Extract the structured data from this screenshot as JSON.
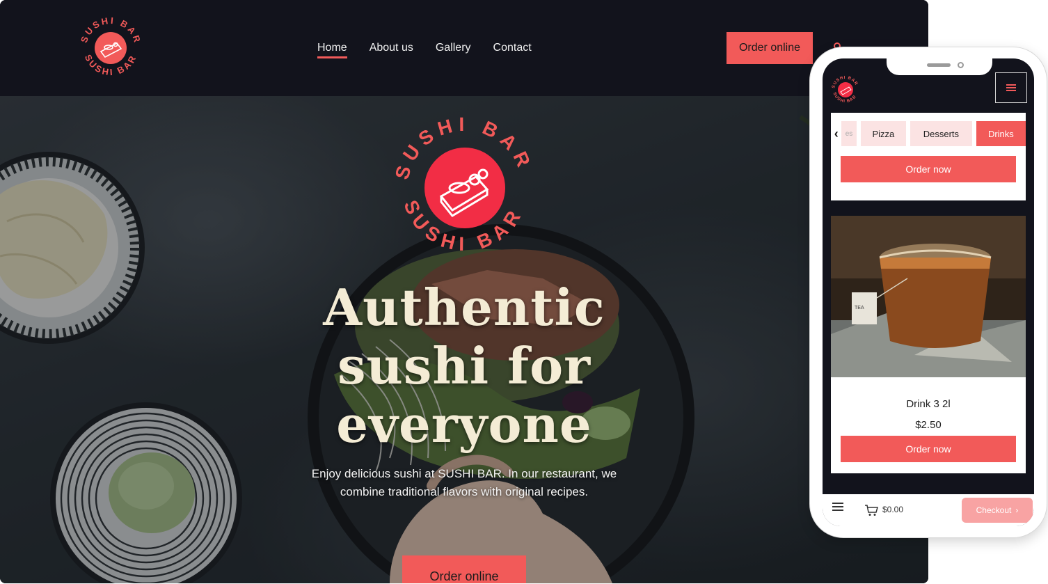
{
  "brand": {
    "logo_text": "SUSHI BAR",
    "accent_color": "#f25a59",
    "dark_bg": "#12131c",
    "hero_text_color": "#f4ecd5"
  },
  "nav": {
    "items": [
      {
        "label": "Home",
        "active": true
      },
      {
        "label": "About us",
        "active": false
      },
      {
        "label": "Gallery",
        "active": false
      },
      {
        "label": "Contact",
        "active": false
      }
    ],
    "order_button": "Order online",
    "user_icon": "user-icon"
  },
  "hero": {
    "title_line1": "Authentic",
    "title_line2": "sushi for",
    "title_line3": "everyone",
    "description": "Enjoy delicious sushi at SUSHI BAR. In our restaurant, we combine traditional flavors with original recipes.",
    "cta": "Order online"
  },
  "mobile": {
    "menu_icon": "hamburger-icon",
    "tabs": [
      {
        "label": "Pizza",
        "active": false
      },
      {
        "label": "Desserts",
        "active": false
      },
      {
        "label": "Drinks",
        "active": true
      }
    ],
    "partial_tab": "es",
    "order_now_top": "Order now",
    "card": {
      "name": "Drink 3 2l",
      "price": "$2.50",
      "button": "Order now"
    },
    "bottom_bar": {
      "cart_total": "$0.00",
      "checkout": "Checkout",
      "checkout_icon": "chevron-right-icon"
    }
  }
}
